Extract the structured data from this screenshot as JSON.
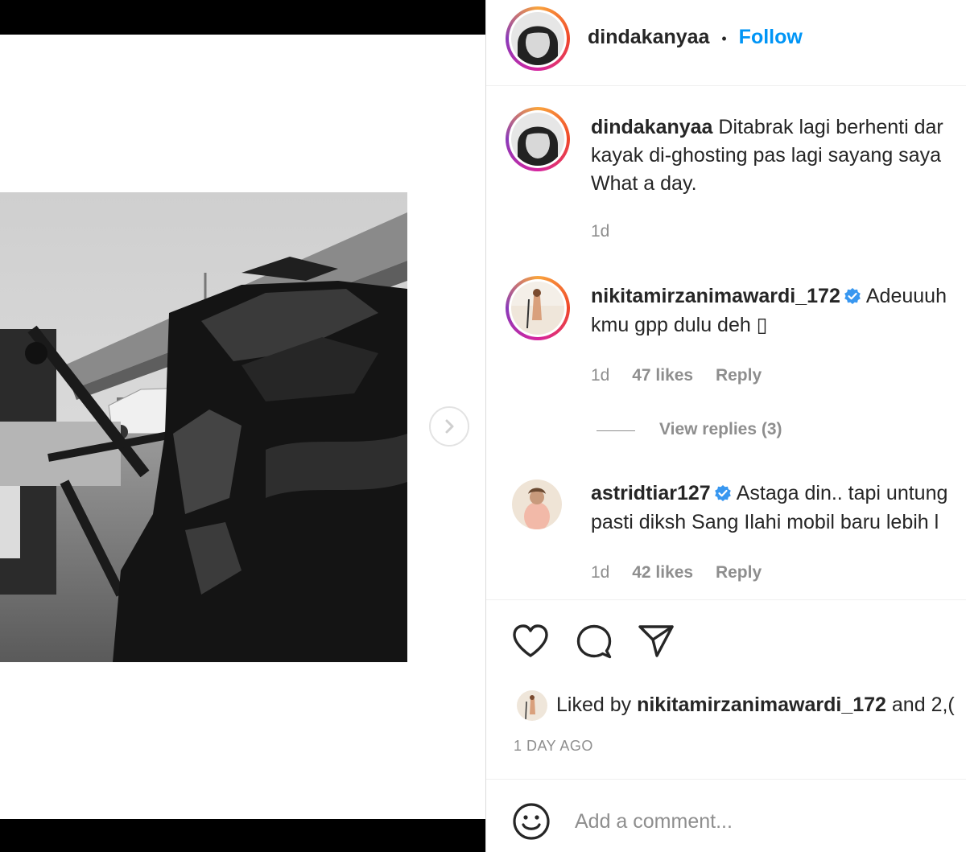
{
  "post": {
    "author": "dindakanyaa",
    "separator": "•",
    "follow_label": "Follow",
    "caption_lines": [
      "Ditabrak lagi berhenti dar",
      "kayak di-ghosting pas lagi sayang saya",
      "What a day."
    ],
    "caption_time": "1d"
  },
  "comments": [
    {
      "username": "nikitamirzanimawardi_172",
      "verified": true,
      "lines": [
        "Adeuuuh",
        "kmu gpp dulu deh ▯"
      ],
      "time": "1d",
      "likes": "47 likes",
      "reply_label": "Reply",
      "view_replies": "View replies (3)"
    },
    {
      "username": "astridtiar127",
      "verified": true,
      "lines": [
        "Astaga din.. tapi untung",
        "pasti diksh Sang Ilahi mobil baru lebih l"
      ],
      "time": "1d",
      "likes": "42 likes",
      "reply_label": "Reply"
    }
  ],
  "actions": {
    "like_icon": "heart-icon",
    "comment_icon": "comment-bubble-icon",
    "share_icon": "paper-plane-icon"
  },
  "likes_summary": {
    "prefix": "Liked by",
    "username": "nikitamirzanimawardi_172",
    "suffix": "and 2,("
  },
  "timestamp": "1 DAY AGO",
  "comment_box": {
    "emoji_icon": "smiley-icon",
    "placeholder": "Add a comment..."
  },
  "colors": {
    "link": "#0095f6",
    "text": "#262626",
    "muted": "#8e8e8e",
    "verified": "#3897f0"
  }
}
